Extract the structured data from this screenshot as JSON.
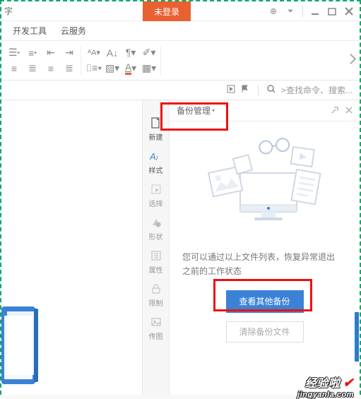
{
  "titlebar": {
    "left_text": "字",
    "login": "未登录"
  },
  "tabs": {
    "dev": "开发工具",
    "cloud": "云服务"
  },
  "search": {
    "placeholder": ">查找命令、搜索..."
  },
  "side": {
    "new": "新建",
    "style": "样式",
    "select": "选择",
    "shape": "形状",
    "props": "属性",
    "limit": "限制",
    "legend": "传图"
  },
  "backup": {
    "title": "备份管理",
    "msg1": "您可以通过以上文件列表，恢复异常退出",
    "msg2": "之前的工作状态",
    "view_other": "查看其他备份",
    "clear": "清除备份文件"
  },
  "watermark": {
    "cn": "经验啦",
    "en": "jingyanla.com"
  }
}
